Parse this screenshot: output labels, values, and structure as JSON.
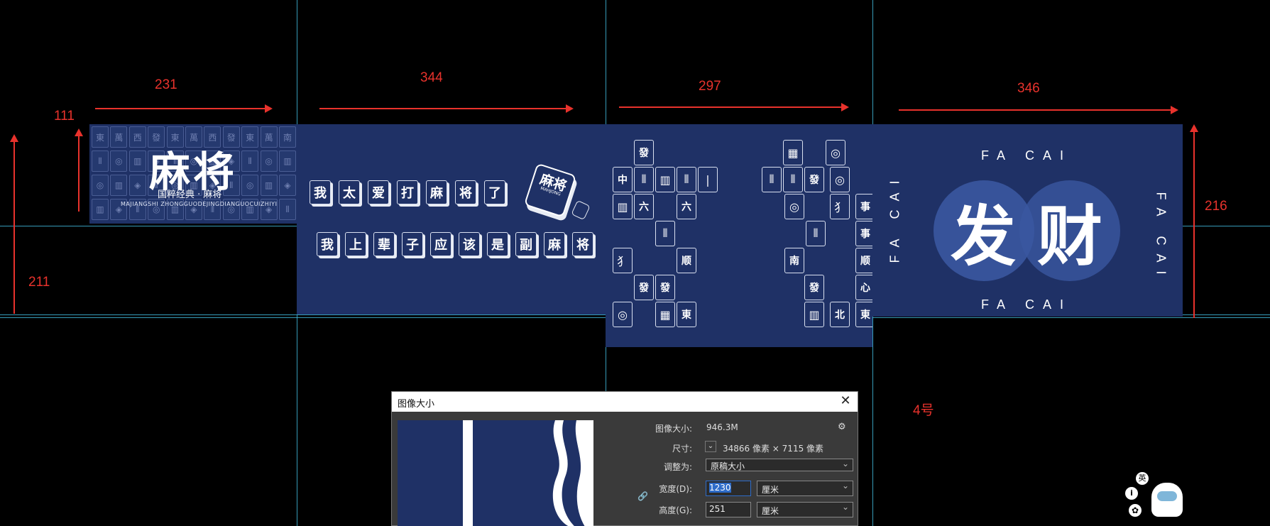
{
  "dimensions": {
    "w1": "231",
    "w2": "344",
    "w3": "297",
    "w4": "346",
    "h1": "111",
    "h2": "211",
    "h3": "216",
    "label4": "4号"
  },
  "panel1": {
    "title": "麻将",
    "subtitle": "国粹经典 · 麻将",
    "pinyin": "MAJIANGSHI ZHONGGUODEJINGDIANGUOCUIZHIYI",
    "bg_tiles": [
      "東",
      "萬",
      "西",
      "發",
      "東",
      "萬",
      "西",
      "發",
      "東",
      "萬",
      "南"
    ]
  },
  "panel2": {
    "row1": [
      "我",
      "太",
      "爱",
      "打",
      "麻",
      "将",
      "了"
    ],
    "row2": [
      "我",
      "上",
      "辈",
      "子",
      "应",
      "该",
      "是",
      "副",
      "麻",
      "将"
    ],
    "logo_main": "麻将",
    "logo_small": "MAHJONG"
  },
  "panel3": {
    "tiles": [
      "發",
      "中",
      "六",
      "六",
      "大",
      "顺",
      "發",
      "發",
      "東",
      "發",
      "南",
      "事",
      "事",
      "顺",
      "發",
      "心",
      "北",
      "東"
    ]
  },
  "panel4": {
    "char1": "发",
    "char2": "财",
    "side_text": "FA CAI",
    "colors": {
      "circle": "#3a58a0",
      "panel": "#1f3166"
    }
  },
  "dialog": {
    "title": "图像大小",
    "close": "✕",
    "size_label": "图像大小:",
    "size_value": "946.3M",
    "dims_label": "尺寸:",
    "dims_value": "34866 像素 × 7115 像素",
    "fit_label": "调整为:",
    "fit_value": "原稿大小",
    "width_label": "宽度(D):",
    "width_value": "1230",
    "width_unit": "厘米",
    "height_label": "高度(G):",
    "height_value": "251",
    "height_unit": "厘米"
  },
  "ime": {
    "lang": "英"
  }
}
